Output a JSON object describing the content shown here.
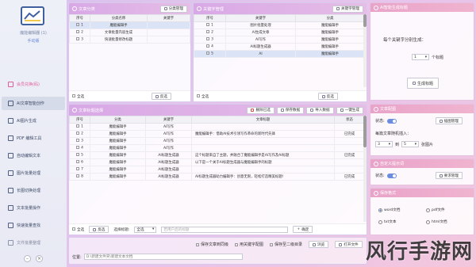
{
  "sidebar": {
    "title": "魔能编辑器 (1)",
    "version": "手动版",
    "items": [
      {
        "label": "会员兑换(码)"
      },
      {
        "label": "AI文章智能创作"
      },
      {
        "label": "AI图片生成"
      },
      {
        "label": "PDF 编辑工具"
      },
      {
        "label": "自动编辑文本"
      },
      {
        "label": "图片批量处理"
      },
      {
        "label": "长图切换处理"
      },
      {
        "label": "文本批量操作"
      },
      {
        "label": "快速批量查找"
      },
      {
        "label": "文件批量整理"
      }
    ]
  },
  "category_panel": {
    "title": "文章分类",
    "manage_label": "分类管理",
    "columns": [
      "序号",
      "分类名称",
      "关键字"
    ],
    "rows": [
      {
        "no": "1",
        "name": "魔能编辑手"
      },
      {
        "no": "2",
        "name": "文章批量内容生成"
      },
      {
        "no": "3",
        "name": "快速批量修改标题"
      }
    ],
    "select_all": "全选",
    "invert": "反选"
  },
  "keyword_panel": {
    "title": "关键字管理",
    "manage_label": "关键字管理",
    "columns": [
      "序号",
      "关键字",
      "分类"
    ],
    "rows": [
      {
        "no": "1",
        "kw": "图片批量处理",
        "cat": "魔能编辑手"
      },
      {
        "no": "2",
        "kw": "AI生成文章",
        "cat": "魔能编辑手"
      },
      {
        "no": "3",
        "kw": "AI写作",
        "cat": "魔能编辑手"
      },
      {
        "no": "4",
        "kw": "AI标题生成器",
        "cat": "魔能编辑手"
      },
      {
        "no": "5",
        "kw": "AI",
        "cat": "魔能编辑手"
      }
    ],
    "select_all": "全选",
    "invert": "反选"
  },
  "title_panel": {
    "title": "文章标题选择",
    "delete_label": "删除已选",
    "save_label": "保存数据",
    "import_label": "导入数据",
    "gen_label": "一键生成",
    "columns": [
      "序号",
      "分类",
      "关键字",
      "文章标题",
      "状态"
    ],
    "rows": [
      {
        "no": "1",
        "cat": "魔能编辑手",
        "kw": "AI写作",
        "title": "",
        "status": ""
      },
      {
        "no": "2",
        "cat": "魔能编辑手",
        "kw": "AI写作",
        "title": "魔能编辑手：借助AI技术引领写作革命的新时代先锋",
        "status": "已完成"
      },
      {
        "no": "3",
        "cat": "魔能编辑手",
        "kw": "AI写作",
        "title": "",
        "status": ""
      },
      {
        "no": "4",
        "cat": "魔能编辑手",
        "kw": "AI写作",
        "title": "",
        "status": ""
      },
      {
        "no": "5",
        "cat": "魔能编辑手",
        "kw": "AI标题生成器",
        "title": "这个标题来自了主题，并融合了魔能编辑手是AI写作及AI标题",
        "status": "已完成"
      },
      {
        "no": "6",
        "cat": "魔能编辑手",
        "kw": "AI标题生成器",
        "title": "以下是一个关于AI标题生成器与魔能编辑手的标题",
        "status": ""
      },
      {
        "no": "7",
        "cat": "魔能编辑手",
        "kw": "AI标题生成器",
        "title": "",
        "status": ""
      },
      {
        "no": "8",
        "cat": "魔能编辑手",
        "kw": "AI标题生成器",
        "title": "AI标题生成器助力编辑手：创意无限，轻松打造精美标题!",
        "status": "已完成"
      }
    ],
    "select_all": "全选",
    "invert": "反选",
    "choose_label": "选择标题:",
    "choose_value": "全选",
    "path_placeholder": "若用户后的标题",
    "confirm": "确定"
  },
  "bottom_bar": {
    "options": [
      "保存文章到同级",
      "用关键字配图",
      "保存至二级目录"
    ],
    "browse": "浏览",
    "open": "打开文件",
    "path_label": "位置:",
    "path_value": "D:\\新建文件夹\\新建文本文档"
  },
  "right": {
    "gen_title": "AI智能生成标题",
    "per_keyword_label": "每个关键字分别生成：",
    "count_value": "1",
    "count_unit": "个标题",
    "gen_button": "生成标题",
    "article_box_title": "文章配图",
    "status_label": "状态:",
    "img_manage": "插图管理",
    "insert_label": "每篇文章随机插入：",
    "from_value": "3",
    "to_label": "到",
    "to_value": "5",
    "to_unit": "张图片",
    "kw_box_title": "自定义提示词",
    "kw_status": "状态:",
    "kw_manage": "要求管理",
    "save_box_title": "保存格式",
    "formats": [
      "word文档",
      "pdf文件",
      "txt文本",
      "html文档"
    ],
    "selected_format": "word文档"
  },
  "watermark": "风行手游网"
}
